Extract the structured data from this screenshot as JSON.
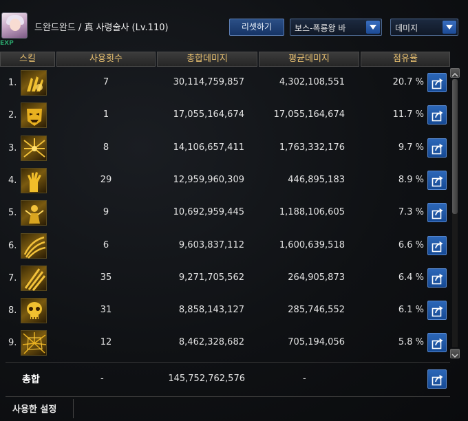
{
  "header": {
    "exp_label": "EXP",
    "character_title": "드완드완드 / 真 사령술사 (Lv.110)",
    "reset_button": "리셋하기",
    "target_select": "보스-폭룡왕 바",
    "metric_select": "데미지"
  },
  "columns": [
    "스킬",
    "사용횟수",
    "총합데미지",
    "평균데미지",
    "점유율"
  ],
  "rows": [
    {
      "rank": "1.",
      "icon": "claw-strike-icon",
      "count": "7",
      "total": "30,114,759,857",
      "avg": "4,302,108,551",
      "share": "20.7 %"
    },
    {
      "rank": "2.",
      "icon": "demon-mask-icon",
      "count": "1",
      "total": "17,055,164,674",
      "avg": "17,055,164,674",
      "share": "11.7 %"
    },
    {
      "rank": "3.",
      "icon": "shadow-burst-icon",
      "count": "8",
      "total": "14,106,657,411",
      "avg": "1,763,332,176",
      "share": "9.7 %"
    },
    {
      "rank": "4.",
      "icon": "grasping-hand-icon",
      "count": "29",
      "total": "12,959,960,309",
      "avg": "446,895,183",
      "share": "8.9 %"
    },
    {
      "rank": "5.",
      "icon": "summon-figure-icon",
      "count": "9",
      "total": "10,692,959,445",
      "avg": "1,188,106,605",
      "share": "7.3 %"
    },
    {
      "rank": "6.",
      "icon": "slash-wave-icon",
      "count": "6",
      "total": "9,603,837,112",
      "avg": "1,600,639,518",
      "share": "6.6 %"
    },
    {
      "rank": "7.",
      "icon": "claw-slash-icon",
      "count": "35",
      "total": "9,271,705,562",
      "avg": "264,905,873",
      "share": "6.4 %"
    },
    {
      "rank": "8.",
      "icon": "skull-icon",
      "count": "31",
      "total": "8,858,143,127",
      "avg": "285,746,552",
      "share": "6.1 %"
    },
    {
      "rank": "9.",
      "icon": "web-shatter-icon",
      "count": "12",
      "total": "8,462,328,682",
      "avg": "705,194,056",
      "share": "5.8 %"
    }
  ],
  "total": {
    "label": "총합",
    "count": "-",
    "sum": "145,752,762,576",
    "avg": "-"
  },
  "footer": {
    "settings_label": "사용한 설정"
  },
  "colors": {
    "header_text": "#e8c070",
    "accent_button": "#2c67b8",
    "icon_gold": "#d9a520"
  }
}
